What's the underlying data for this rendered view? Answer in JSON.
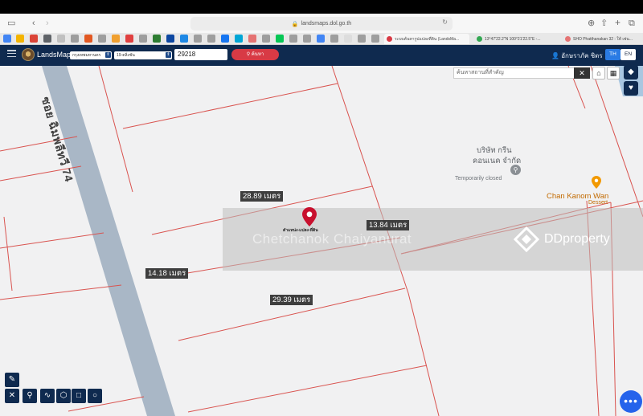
{
  "browser": {
    "url": "landsmaps.dol.go.th",
    "tabs": [
      {
        "label": "ระบบค้นหารูปแปลงที่ดิน (LandsMa..."
      },
      {
        "label": "13°47'22.2\"N 100°21'22.5\"E -..."
      },
      {
        "label": "SHO Phatthanakan 32 : ให้ เช่น..."
      }
    ]
  },
  "app": {
    "brand": "LandsMaps",
    "province": "กรุงเทพมหานคร",
    "district": "19-ตลิ่งชัน",
    "parcel_no": "29218",
    "search_label": "ค้นหา",
    "user_name": "อักษราภัค ชิตร",
    "lang_th": "TH",
    "lang_en": "EN"
  },
  "map": {
    "search_placeholder": "ค้นหาสถานที่สำคัญ",
    "search_clear": "✕",
    "road_label": "ซอย ฉิมพลีทวี 74",
    "dimensions": [
      "28.89 เมตร",
      "13.84 เมตร",
      "14.18 เมตร",
      "29.39 เมตร"
    ],
    "pin_label": "ตำแหน่ง-แปลง-ที่ดิน",
    "poi": [
      {
        "name": "บริษัท กรีน",
        "line2": "คอนเนค จำกัด",
        "status": "Temporarily closed"
      },
      {
        "name": "Chan Kanom Wan",
        "category": "Dessert"
      }
    ],
    "watermark_name": "Chetchanok Chaiyanurat",
    "watermark_brand": "DDproperty",
    "fab_label": "•••"
  },
  "icons": [
    "hamburger-icon",
    "layers-icon",
    "heart-icon",
    "home-icon",
    "grid-icon",
    "ruler-icon",
    "pin-icon",
    "route-icon",
    "polygon-icon",
    "square-icon",
    "circle-icon"
  ],
  "colors": {
    "header": "#0f2a4f",
    "accent": "#d83a45",
    "parcel_line": "#d9534f",
    "road": "#a9b7c6"
  }
}
